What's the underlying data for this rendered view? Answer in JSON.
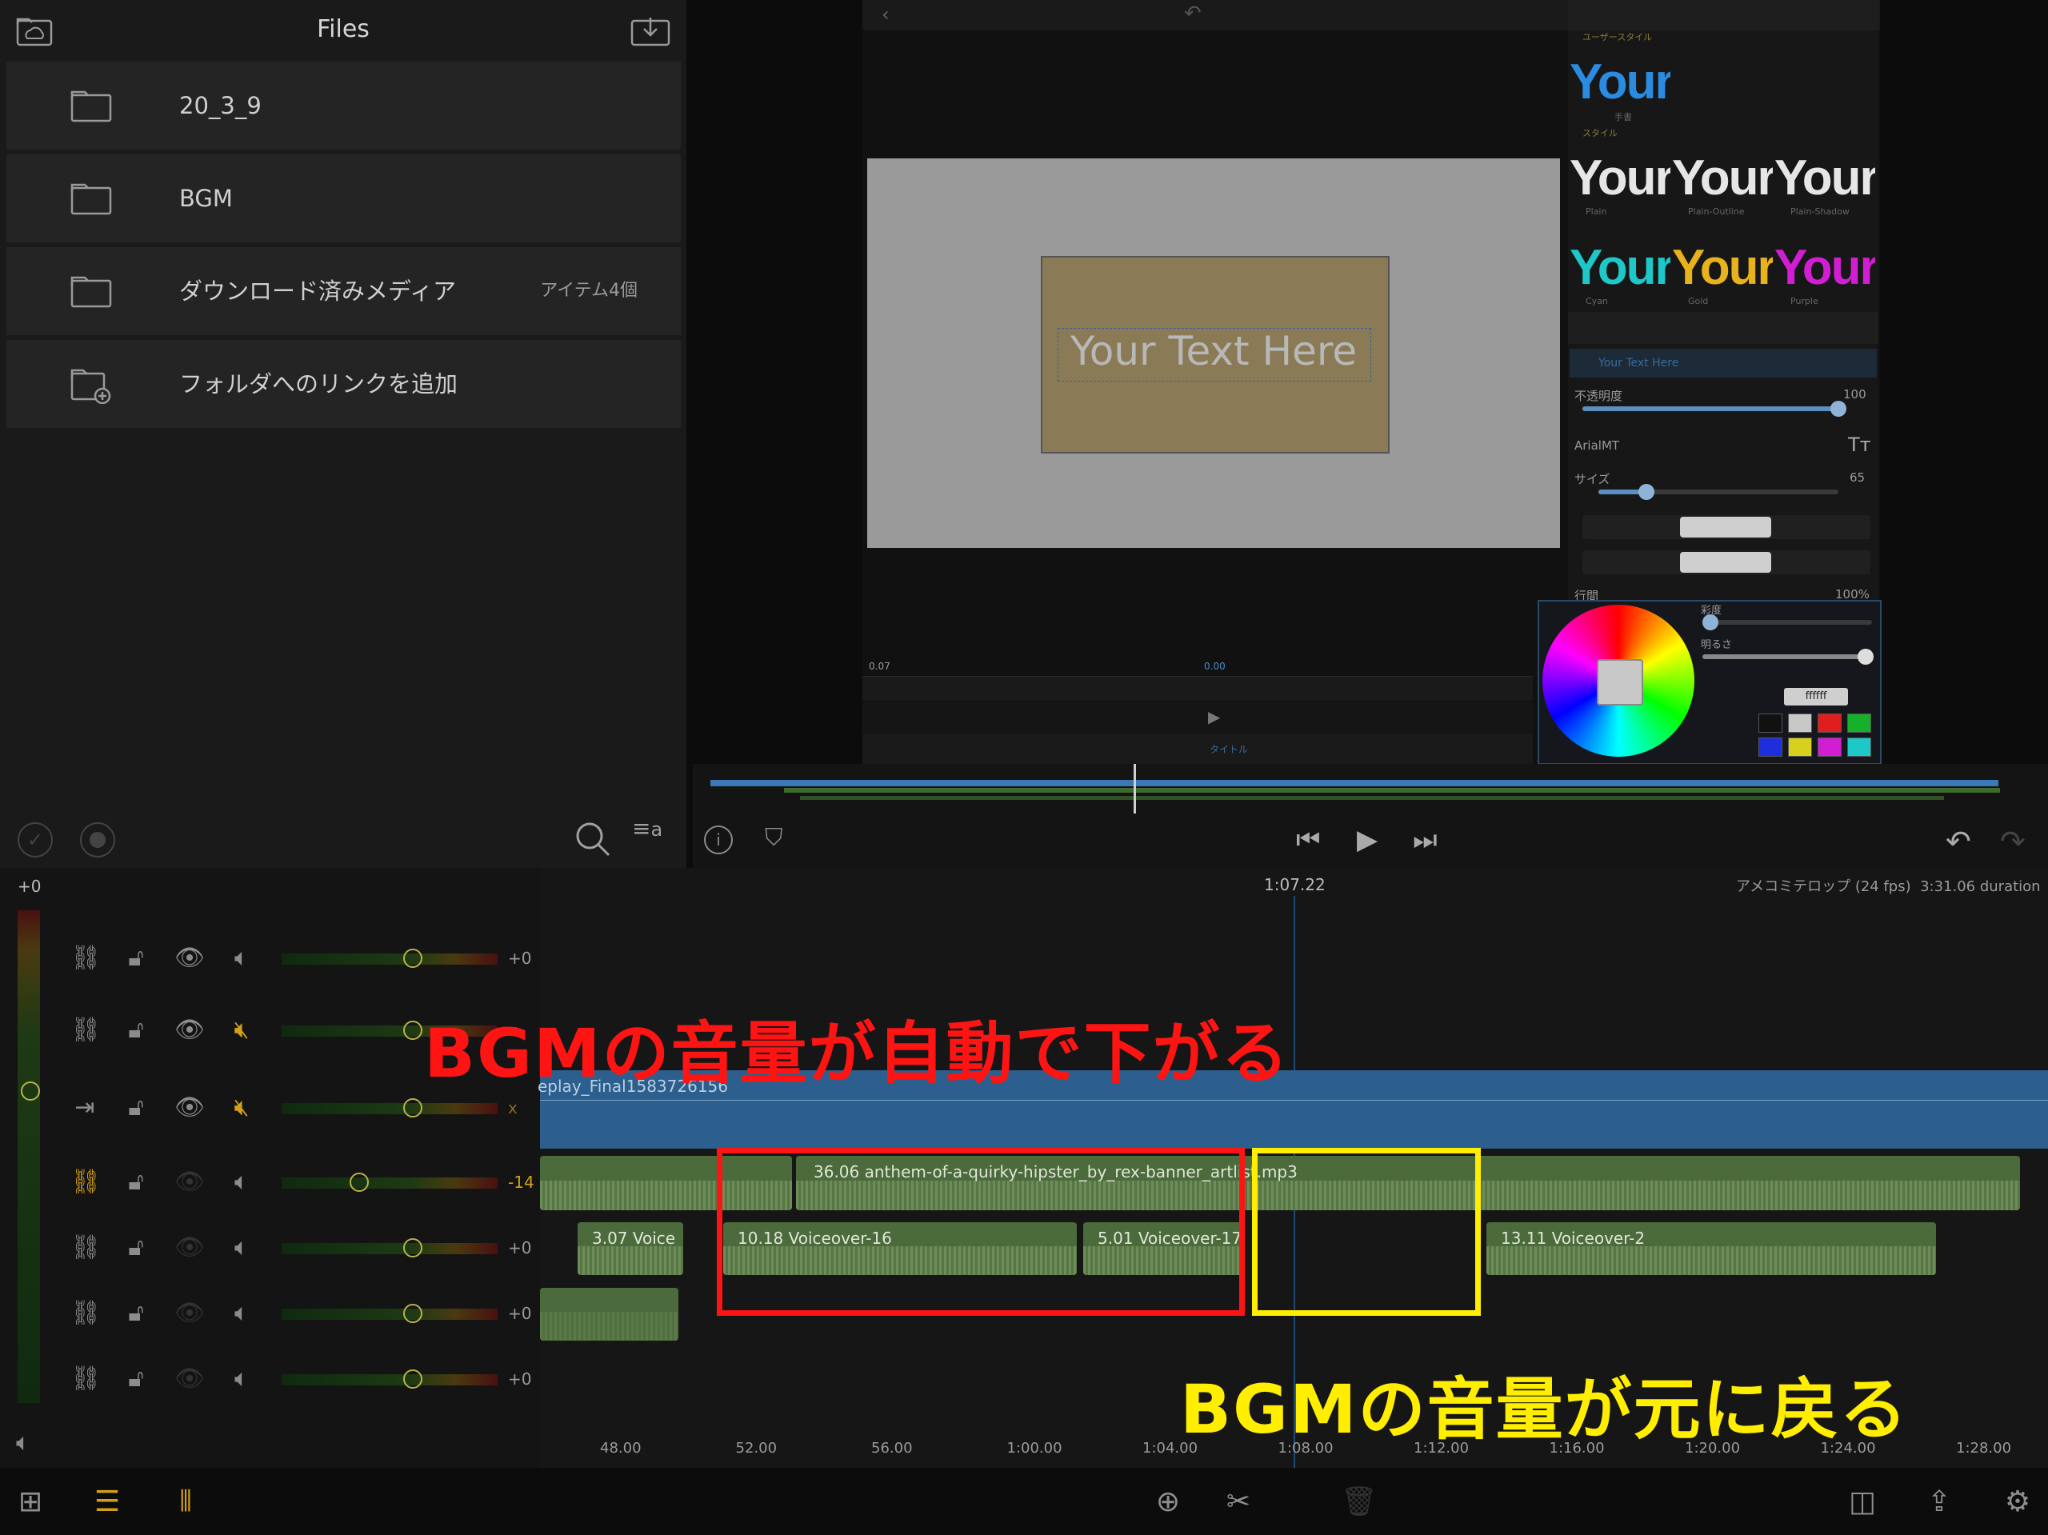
{
  "files": {
    "title": "Files",
    "items": [
      {
        "label": "20_3_9",
        "count": ""
      },
      {
        "label": "BGM",
        "count": ""
      },
      {
        "label": "ダウンロード済みメディア",
        "count": "アイテム4個"
      },
      {
        "label": "フォルダへのリンクを追加",
        "count": ""
      }
    ]
  },
  "preview": {
    "text_overlay": "Your Text Here",
    "time_left": "0.07",
    "time_mid": "0.00"
  },
  "inspector": {
    "user_style_header": "ユーザースタイル",
    "user_style_caption": "手書",
    "style_header": "スタイル",
    "style_tiles": [
      {
        "text": "Your",
        "caption": "Plain",
        "color": "#e6e6e6"
      },
      {
        "text": "Your",
        "caption": "Plain-Outline",
        "color": "#e6e6e6"
      },
      {
        "text": "Your",
        "caption": "Plain-Shadow",
        "color": "#e6e6e6"
      },
      {
        "text": "Your",
        "caption": "Cyan",
        "color": "#1ec8c8"
      },
      {
        "text": "Your",
        "caption": "Gold",
        "color": "#e8b21c"
      },
      {
        "text": "Your",
        "caption": "Purple",
        "color": "#d21ed2"
      }
    ],
    "user_style_tile": {
      "text": "Your",
      "color": "#2a8be0"
    },
    "layer_name": "Your Text Here",
    "opacity_label": "不透明度",
    "opacity_value": "100",
    "opacity": 1.0,
    "font_name": "ArialMT",
    "size_label": "サイズ",
    "size_value": "65",
    "size_fraction": 0.2,
    "line_label": "行間",
    "line_value": "100%",
    "saturation_label": "彩度",
    "brightness_label": "明るさ",
    "hex_value": "ffffff",
    "swatches": [
      "#111111",
      "#c8c8c8",
      "#e01e1e",
      "#16b02a",
      "#1e2edc",
      "#d8d01e",
      "#d21ed2",
      "#1ec8c8"
    ],
    "bottom_tab_label": "タイトル"
  },
  "timeline": {
    "playhead_time": "1:07.22",
    "project_info": "アメコミテロップ (24 fps)  3:31.06 duration",
    "master_db": "+0",
    "tracks": [
      {
        "db": "+0",
        "muted": false,
        "chain": "link",
        "gain": 0.6
      },
      {
        "db": "x",
        "muted": true,
        "chain": "link",
        "gain": 0.6
      },
      {
        "db": "x",
        "muted": true,
        "chain": "arrow",
        "gain": 0.6
      },
      {
        "db": "-14",
        "muted": false,
        "chain": "link-active",
        "gain": 0.35
      },
      {
        "db": "+0",
        "muted": false,
        "chain": "link",
        "gain": 0.6
      },
      {
        "db": "+0",
        "muted": false,
        "chain": "link",
        "gain": 0.6
      },
      {
        "db": "+0",
        "muted": false,
        "chain": "link",
        "gain": 0.6
      }
    ],
    "video_clip_label": "eplay_Final1583726156",
    "bgm_clip_label": "36.06   anthem-of-a-quirky-hipster_by_rex-banner_artlist.mp3",
    "voice_clips": [
      {
        "label": "3.07   Voice"
      },
      {
        "label": "10.18   Voiceover-16"
      },
      {
        "label": "5.01   Voiceover-17"
      },
      {
        "label": "13.11   Voiceover-2"
      }
    ],
    "ticks": [
      "48.00",
      "52.00",
      "56.00",
      "1:00.00",
      "1:04.00",
      "1:08.00",
      "1:12.00",
      "1:16.00",
      "1:20.00",
      "1:24.00",
      "1:28.00"
    ]
  },
  "annotations": {
    "red_text": "BGMの音量が自動で下がる",
    "yellow_text": "BGMの音量が元に戻る",
    "red_color": "#ff1414",
    "yellow_color": "#ffee00"
  },
  "icons": {
    "files_header_left": "cloud-folder-icon",
    "files_header_right": "import-icon"
  }
}
